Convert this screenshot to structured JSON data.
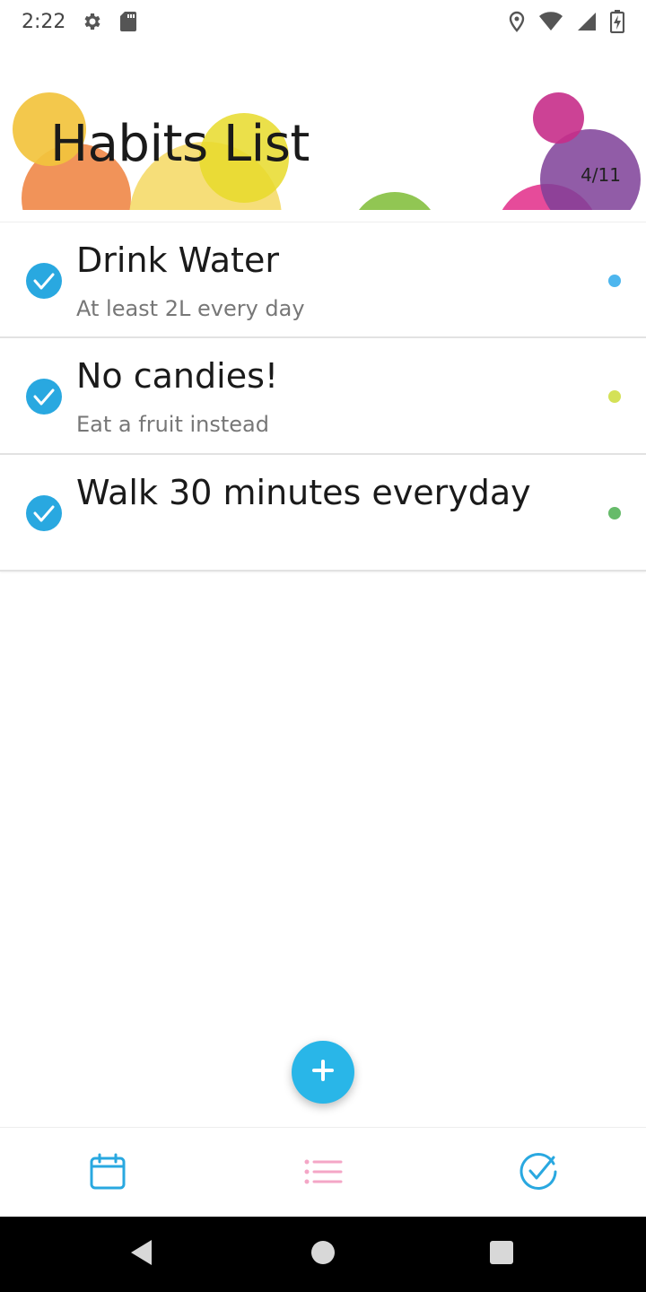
{
  "status_bar": {
    "time": "2:22",
    "icons_left": [
      "gear-icon",
      "sd-card-icon"
    ],
    "icons_right": [
      "location-icon",
      "wifi-icon",
      "signal-icon",
      "battery-charging-icon"
    ]
  },
  "header": {
    "title": "Habits List",
    "progress": "4/11"
  },
  "habits": [
    {
      "title": "Drink Water",
      "subtitle": "At least 2L every day",
      "checked": true,
      "color": "#4db6ee"
    },
    {
      "title": "No candies!",
      "subtitle": "Eat a fruit instead",
      "checked": true,
      "color": "#d4e157"
    },
    {
      "title": "Walk 30 minutes everyday",
      "subtitle": "",
      "checked": true,
      "color": "#66bb6a"
    }
  ],
  "fab": {
    "icon": "plus-icon",
    "color": "#29b6e8"
  },
  "bottom_nav": {
    "items": [
      {
        "icon": "calendar-icon",
        "color": "#29a8e0"
      },
      {
        "icon": "list-icon",
        "color": "#f4a6c6"
      },
      {
        "icon": "check-circle-icon",
        "color": "#29a8e0"
      }
    ]
  },
  "colors": {
    "accent": "#29b6e8",
    "check": "#29a8e0"
  }
}
